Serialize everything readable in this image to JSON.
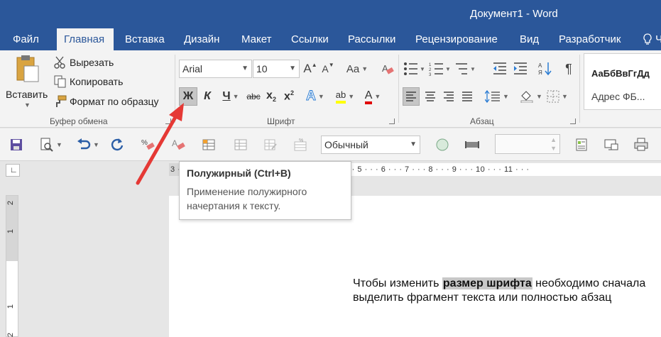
{
  "window": {
    "title": "Документ1 - Word"
  },
  "tabs": [
    {
      "label": "Файл"
    },
    {
      "label": "Главная"
    },
    {
      "label": "Вставка"
    },
    {
      "label": "Дизайн"
    },
    {
      "label": "Макет"
    },
    {
      "label": "Ссылки"
    },
    {
      "label": "Рассылки"
    },
    {
      "label": "Рецензирование"
    },
    {
      "label": "Вид"
    },
    {
      "label": "Разработчик"
    },
    {
      "label": "Ч"
    }
  ],
  "clipboard": {
    "paste_label": "Вставить",
    "cut_label": "Вырезать",
    "copy_label": "Копировать",
    "format_painter_label": "Формат по образцу",
    "group_label": "Буфер обмена"
  },
  "font": {
    "family_value": "Arial",
    "size_value": "10",
    "group_label": "Шрифт",
    "bold_glyph": "Ж",
    "italic_glyph": "К",
    "underline_glyph": "Ч",
    "strike_glyph": "abc",
    "case_glyph": "Aa",
    "grow_glyph": "A",
    "shrink_glyph": "A",
    "text_effect_glyph": "A",
    "highlight_glyph": "ab",
    "font_color_glyph": "A"
  },
  "paragraph": {
    "group_label": "Абзац"
  },
  "styles": {
    "sample": "АаБбВвГгДд",
    "name": "Адрес ФБ..."
  },
  "qat": {
    "style_value": "Обычный"
  },
  "ruler": {
    "ticks": "3 · · · 2 · · · 1 · · · | · · · 1 · · · 2 · · · 3 · · · 4 · · · 5 · · · 6 · · · 7 · · · 8 · · · 9 · · · 10 · · · 11 · · ·"
  },
  "vruler": {
    "n1": "2",
    "n2": "1",
    "n3": "1",
    "n4": "2"
  },
  "tooltip": {
    "title": "Полужирный (Ctrl+B)",
    "body": "Применение полужирного начертания к тексту."
  },
  "document": {
    "line1_before": "Чтобы изменить ",
    "line1_highlight": "размер шрифта",
    "line1_after": " необходимо сначала",
    "line2": "выделить фрагмент текста или полностью абзац"
  },
  "colors": {
    "title_bar": "#2b579a",
    "ribbon_bg": "#f3f3f3",
    "annotation_arrow": "#e53935",
    "font_color_underline": "#e00000",
    "highlight_color": "#ffff00"
  },
  "icons": [
    "paste-icon",
    "scissors-icon",
    "copy-icon",
    "format-painter-icon",
    "clear-format-icon",
    "save-icon",
    "print-preview-icon",
    "undo-icon",
    "redo-icon",
    "show-marks-icon",
    "sort-icon",
    "line-spacing-icon",
    "shading-icon",
    "borders-icon"
  ]
}
